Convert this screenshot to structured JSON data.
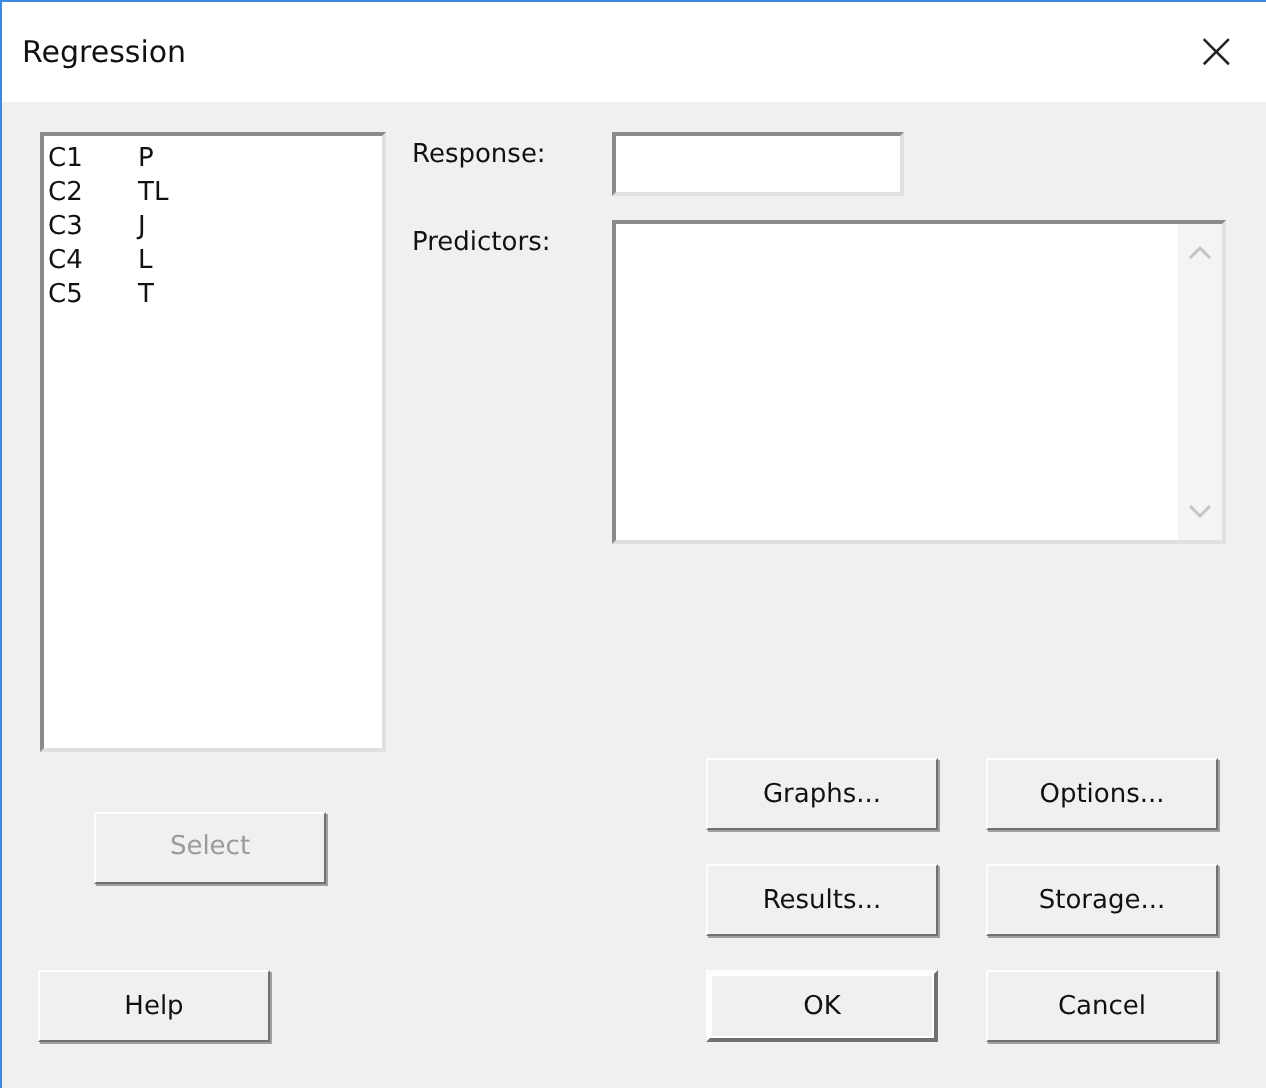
{
  "window": {
    "title": "Regression",
    "close": "×"
  },
  "variables": [
    {
      "column": "C1",
      "name": "P"
    },
    {
      "column": "C2",
      "name": "TL"
    },
    {
      "column": "C3",
      "name": "J"
    },
    {
      "column": "C4",
      "name": "L"
    },
    {
      "column": "C5",
      "name": "T"
    }
  ],
  "response": {
    "label": "Response:"
  },
  "predictors": {
    "label": "Predictors:"
  },
  "select_button": {
    "label": "Select",
    "disabled": true
  },
  "help_button": {
    "label": "Help"
  },
  "buttons": [
    {
      "label": "Graphs...",
      "default": false
    },
    {
      "label": "Options...",
      "default": false
    },
    {
      "label": "Results...",
      "default": false
    },
    {
      "label": "Storage...",
      "default": false
    },
    {
      "label": "OK",
      "default": true
    },
    {
      "label": "Cancel",
      "default": false
    }
  ]
}
